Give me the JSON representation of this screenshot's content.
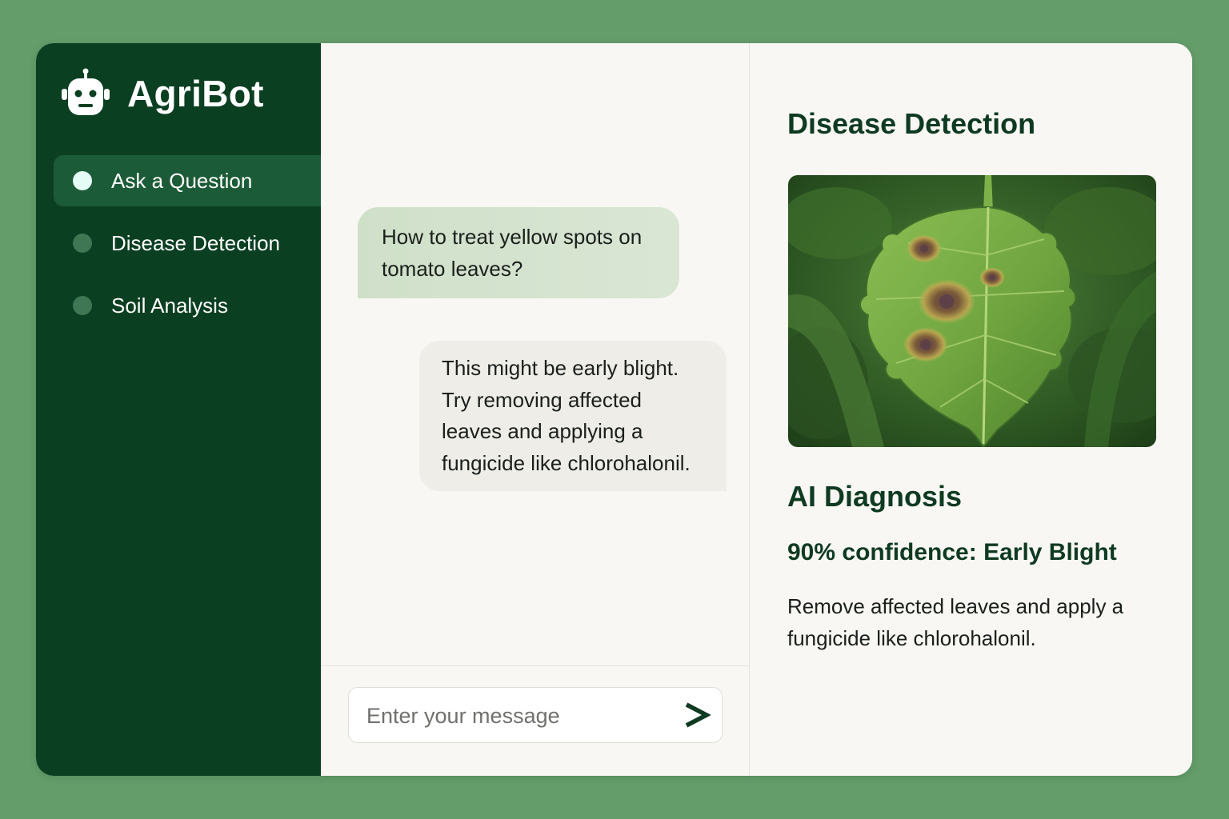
{
  "app": {
    "name": "AgriBot",
    "logo_icon": "robot-icon"
  },
  "sidebar": {
    "items": [
      {
        "label": "Ask a Question",
        "active": true
      },
      {
        "label": "Disease Detection",
        "active": false
      },
      {
        "label": "Soil Analysis",
        "active": false
      }
    ]
  },
  "chat": {
    "messages": [
      {
        "role": "user",
        "text": "How to treat yellow spots on tomato leaves?"
      },
      {
        "role": "bot",
        "text": "This might be early blight. Try removing affected leaves and applying a fungicide like chlorohalonil."
      }
    ],
    "input": {
      "value": "",
      "placeholder": "Enter your message",
      "send_icon": "send-arrow-icon"
    }
  },
  "panel": {
    "title": "Disease Detection",
    "image_subject": "tomato-leaf-with-blight-spots",
    "diagnosis_title": "AI Diagnosis",
    "confidence_text": "90% confidence: Early Blight",
    "advice": "Remove affected leaves and apply a fungicide like chlorohalonil."
  },
  "colors": {
    "page_background": "#649d6a",
    "sidebar": "#0a3f21",
    "sidebar_active": "#1c5b37",
    "active_dot": "#e4fbf6",
    "inactive_dot": "#3f7653",
    "heading": "#0f3a22",
    "user_bubble": "#d3e3cd",
    "bot_bubble": "#eeede8",
    "send_icon": "#0f3a22"
  }
}
